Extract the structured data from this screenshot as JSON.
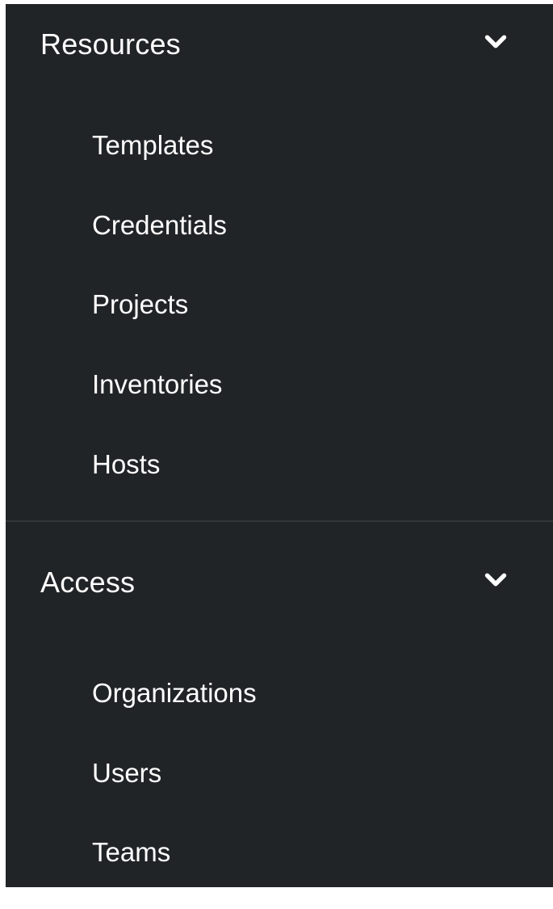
{
  "sidebar": {
    "groups": [
      {
        "title": "Resources",
        "expanded_icon": "chevron-down-icon",
        "items": [
          {
            "label": "Templates"
          },
          {
            "label": "Credentials"
          },
          {
            "label": "Projects"
          },
          {
            "label": "Inventories"
          },
          {
            "label": "Hosts"
          }
        ]
      },
      {
        "title": "Access",
        "expanded_icon": "chevron-down-icon",
        "items": [
          {
            "label": "Organizations"
          },
          {
            "label": "Users"
          },
          {
            "label": "Teams"
          }
        ]
      }
    ]
  },
  "colors": {
    "sidebar_bg": "#212427",
    "text": "#ffffff",
    "divider": "#34373a"
  }
}
